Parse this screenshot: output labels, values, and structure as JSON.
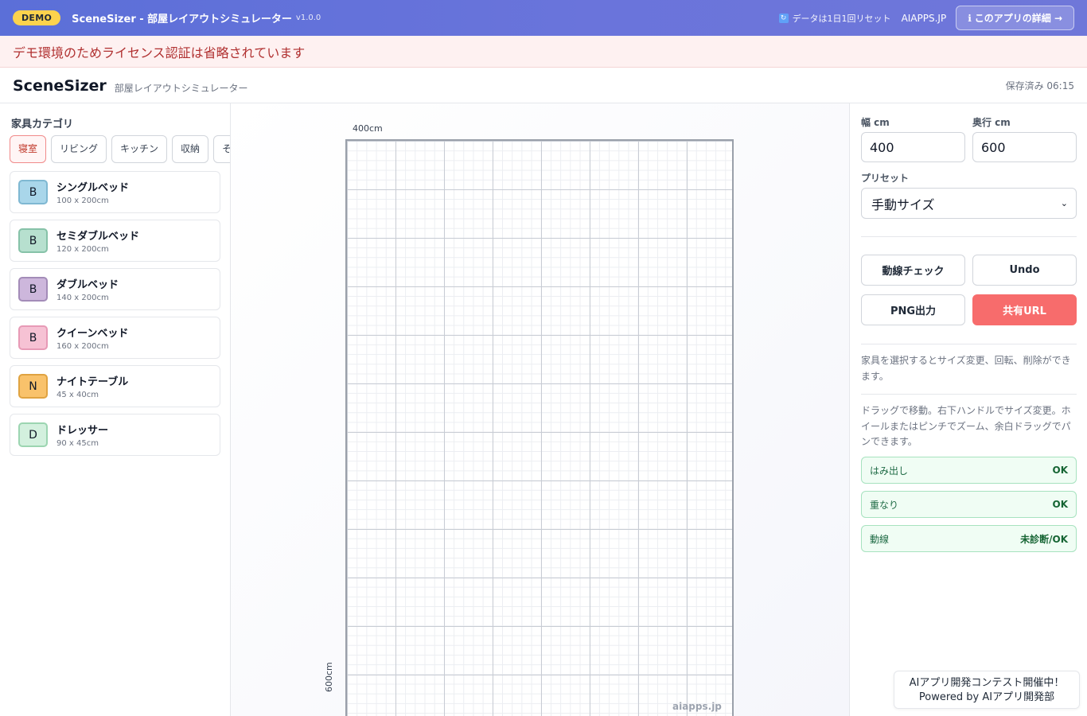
{
  "demo_bar": {
    "badge": "DEMO",
    "title": "SceneSizer - 部屋レイアウトシミュレーター",
    "version": "v1.0.0",
    "reset_note": "データは1日1回リセット",
    "reset_icon": "refresh-icon",
    "site": "AIAPPS.JP",
    "detail_button": "このアプリの詳細 →",
    "detail_icon": "info-icon"
  },
  "notice": "デモ環境のためライセンス認証は省略されています",
  "header": {
    "app_name": "SceneSizer",
    "subtitle": "部屋レイアウトシミュレーター",
    "saved": "保存済み 06:15"
  },
  "left": {
    "category_label": "家具カテゴリ",
    "tabs": [
      "寝室",
      "リビング",
      "キッチン",
      "収納",
      "そ"
    ],
    "active_tab": "寝室",
    "items": [
      {
        "icon": "B",
        "name": "シングルベッド",
        "size": "100 x 200cm",
        "color": "#a9d6ea",
        "border": "#7fb8d2"
      },
      {
        "icon": "B",
        "name": "セミダブルベッド",
        "size": "120 x 200cm",
        "color": "#b7e0cf",
        "border": "#86c2a8"
      },
      {
        "icon": "B",
        "name": "ダブルベッド",
        "size": "140 x 200cm",
        "color": "#cdb7dc",
        "border": "#a38cb8"
      },
      {
        "icon": "B",
        "name": "クイーンベッド",
        "size": "160 x 200cm",
        "color": "#f6c2d4",
        "border": "#e79ab6"
      },
      {
        "icon": "N",
        "name": "ナイトテーブル",
        "size": "45 x 40cm",
        "color": "#f9c26b",
        "border": "#e0a341"
      },
      {
        "icon": "D",
        "name": "ドレッサー",
        "size": "90 x 45cm",
        "color": "#d3f0de",
        "border": "#9cd5b1"
      }
    ]
  },
  "canvas": {
    "width_label": "400cm",
    "depth_label": "600cm",
    "watermark": "aiapps.jp"
  },
  "right": {
    "width_label": "幅 cm",
    "width_value": "400",
    "depth_label": "奥行 cm",
    "depth_value": "600",
    "preset_label": "プリセット",
    "preset_value": "手動サイズ",
    "buttons": {
      "flow_check": "動線チェック",
      "undo": "Undo",
      "png": "PNG出力",
      "share": "共有URL"
    },
    "hint_select": "家具を選択するとサイズ変更、回転、削除ができます。",
    "hint_drag": "ドラッグで移動。右下ハンドルでサイズ変更。ホイールまたはピンチでズーム、余白ドラッグでパンできます。",
    "status": [
      {
        "label": "はみ出し",
        "value": "OK"
      },
      {
        "label": "重なり",
        "value": "OK"
      },
      {
        "label": "動線",
        "value": "未診断/OK"
      }
    ]
  },
  "contest": {
    "line1": "AIアプリ開発コンテスト開催中！",
    "line2": "Powered by AIアプリ開発部"
  },
  "colors": {
    "accent": "#f76c6c",
    "header_gradient_start": "#5b6fd8",
    "badge": "#fcd34d",
    "ok_green": "#166534"
  }
}
